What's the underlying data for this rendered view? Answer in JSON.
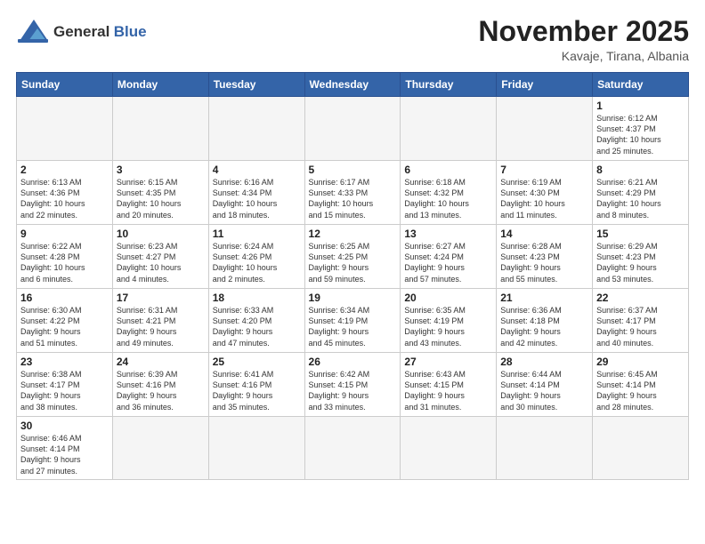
{
  "header": {
    "logo_line1": "General",
    "logo_line2": "Blue",
    "month_year": "November 2025",
    "location": "Kavaje, Tirana, Albania"
  },
  "weekdays": [
    "Sunday",
    "Monday",
    "Tuesday",
    "Wednesday",
    "Thursday",
    "Friday",
    "Saturday"
  ],
  "weeks": [
    [
      {
        "day": "",
        "info": ""
      },
      {
        "day": "",
        "info": ""
      },
      {
        "day": "",
        "info": ""
      },
      {
        "day": "",
        "info": ""
      },
      {
        "day": "",
        "info": ""
      },
      {
        "day": "",
        "info": ""
      },
      {
        "day": "1",
        "info": "Sunrise: 6:12 AM\nSunset: 4:37 PM\nDaylight: 10 hours\nand 25 minutes."
      }
    ],
    [
      {
        "day": "2",
        "info": "Sunrise: 6:13 AM\nSunset: 4:36 PM\nDaylight: 10 hours\nand 22 minutes."
      },
      {
        "day": "3",
        "info": "Sunrise: 6:15 AM\nSunset: 4:35 PM\nDaylight: 10 hours\nand 20 minutes."
      },
      {
        "day": "4",
        "info": "Sunrise: 6:16 AM\nSunset: 4:34 PM\nDaylight: 10 hours\nand 18 minutes."
      },
      {
        "day": "5",
        "info": "Sunrise: 6:17 AM\nSunset: 4:33 PM\nDaylight: 10 hours\nand 15 minutes."
      },
      {
        "day": "6",
        "info": "Sunrise: 6:18 AM\nSunset: 4:32 PM\nDaylight: 10 hours\nand 13 minutes."
      },
      {
        "day": "7",
        "info": "Sunrise: 6:19 AM\nSunset: 4:30 PM\nDaylight: 10 hours\nand 11 minutes."
      },
      {
        "day": "8",
        "info": "Sunrise: 6:21 AM\nSunset: 4:29 PM\nDaylight: 10 hours\nand 8 minutes."
      }
    ],
    [
      {
        "day": "9",
        "info": "Sunrise: 6:22 AM\nSunset: 4:28 PM\nDaylight: 10 hours\nand 6 minutes."
      },
      {
        "day": "10",
        "info": "Sunrise: 6:23 AM\nSunset: 4:27 PM\nDaylight: 10 hours\nand 4 minutes."
      },
      {
        "day": "11",
        "info": "Sunrise: 6:24 AM\nSunset: 4:26 PM\nDaylight: 10 hours\nand 2 minutes."
      },
      {
        "day": "12",
        "info": "Sunrise: 6:25 AM\nSunset: 4:25 PM\nDaylight: 9 hours\nand 59 minutes."
      },
      {
        "day": "13",
        "info": "Sunrise: 6:27 AM\nSunset: 4:24 PM\nDaylight: 9 hours\nand 57 minutes."
      },
      {
        "day": "14",
        "info": "Sunrise: 6:28 AM\nSunset: 4:23 PM\nDaylight: 9 hours\nand 55 minutes."
      },
      {
        "day": "15",
        "info": "Sunrise: 6:29 AM\nSunset: 4:23 PM\nDaylight: 9 hours\nand 53 minutes."
      }
    ],
    [
      {
        "day": "16",
        "info": "Sunrise: 6:30 AM\nSunset: 4:22 PM\nDaylight: 9 hours\nand 51 minutes."
      },
      {
        "day": "17",
        "info": "Sunrise: 6:31 AM\nSunset: 4:21 PM\nDaylight: 9 hours\nand 49 minutes."
      },
      {
        "day": "18",
        "info": "Sunrise: 6:33 AM\nSunset: 4:20 PM\nDaylight: 9 hours\nand 47 minutes."
      },
      {
        "day": "19",
        "info": "Sunrise: 6:34 AM\nSunset: 4:19 PM\nDaylight: 9 hours\nand 45 minutes."
      },
      {
        "day": "20",
        "info": "Sunrise: 6:35 AM\nSunset: 4:19 PM\nDaylight: 9 hours\nand 43 minutes."
      },
      {
        "day": "21",
        "info": "Sunrise: 6:36 AM\nSunset: 4:18 PM\nDaylight: 9 hours\nand 42 minutes."
      },
      {
        "day": "22",
        "info": "Sunrise: 6:37 AM\nSunset: 4:17 PM\nDaylight: 9 hours\nand 40 minutes."
      }
    ],
    [
      {
        "day": "23",
        "info": "Sunrise: 6:38 AM\nSunset: 4:17 PM\nDaylight: 9 hours\nand 38 minutes."
      },
      {
        "day": "24",
        "info": "Sunrise: 6:39 AM\nSunset: 4:16 PM\nDaylight: 9 hours\nand 36 minutes."
      },
      {
        "day": "25",
        "info": "Sunrise: 6:41 AM\nSunset: 4:16 PM\nDaylight: 9 hours\nand 35 minutes."
      },
      {
        "day": "26",
        "info": "Sunrise: 6:42 AM\nSunset: 4:15 PM\nDaylight: 9 hours\nand 33 minutes."
      },
      {
        "day": "27",
        "info": "Sunrise: 6:43 AM\nSunset: 4:15 PM\nDaylight: 9 hours\nand 31 minutes."
      },
      {
        "day": "28",
        "info": "Sunrise: 6:44 AM\nSunset: 4:14 PM\nDaylight: 9 hours\nand 30 minutes."
      },
      {
        "day": "29",
        "info": "Sunrise: 6:45 AM\nSunset: 4:14 PM\nDaylight: 9 hours\nand 28 minutes."
      }
    ],
    [
      {
        "day": "30",
        "info": "Sunrise: 6:46 AM\nSunset: 4:14 PM\nDaylight: 9 hours\nand 27 minutes."
      },
      {
        "day": "",
        "info": ""
      },
      {
        "day": "",
        "info": ""
      },
      {
        "day": "",
        "info": ""
      },
      {
        "day": "",
        "info": ""
      },
      {
        "day": "",
        "info": ""
      },
      {
        "day": "",
        "info": ""
      }
    ]
  ]
}
